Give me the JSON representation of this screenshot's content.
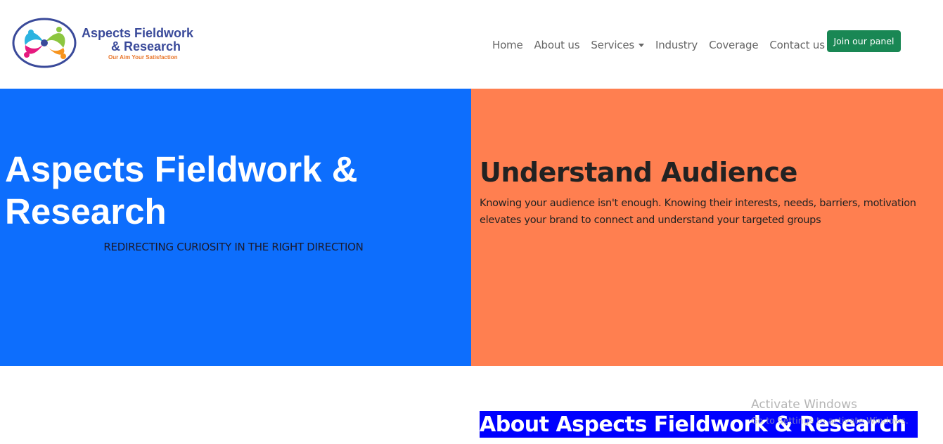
{
  "logo": {
    "title_line1": "Aspects Fieldwork",
    "title_line2": "& Research",
    "tagline": "Our Aim Your Satisfaction"
  },
  "nav": {
    "items": [
      {
        "label": "Home"
      },
      {
        "label": "About us"
      },
      {
        "label": "Services"
      },
      {
        "label": "Industry"
      },
      {
        "label": "Coverage"
      },
      {
        "label": "Contact us"
      }
    ],
    "join_label": "Join our panel"
  },
  "hero_left": {
    "title": "Aspects Fieldwork & Research",
    "subtitle": "REDIRECTING CURIOSITY IN THE RIGHT DIRECTION"
  },
  "hero_right": {
    "title": "Understand Audience",
    "text": "Knowing your audience isn't enough. Knowing their interests, needs, barriers, motivation elevates your brand to connect and understand your targeted groups"
  },
  "about": {
    "title": "About Aspects Fieldwork & Research"
  },
  "watermark": {
    "line1": "Activate Windows",
    "line2": "Go to Settings to activate Windows."
  },
  "colors": {
    "primary": "#0d6efd",
    "coral": "#ff7f50",
    "success": "#198754",
    "about_bg": "#0000ff",
    "logo_text": "#3a4a9a",
    "logo_tag": "#e8762b"
  }
}
